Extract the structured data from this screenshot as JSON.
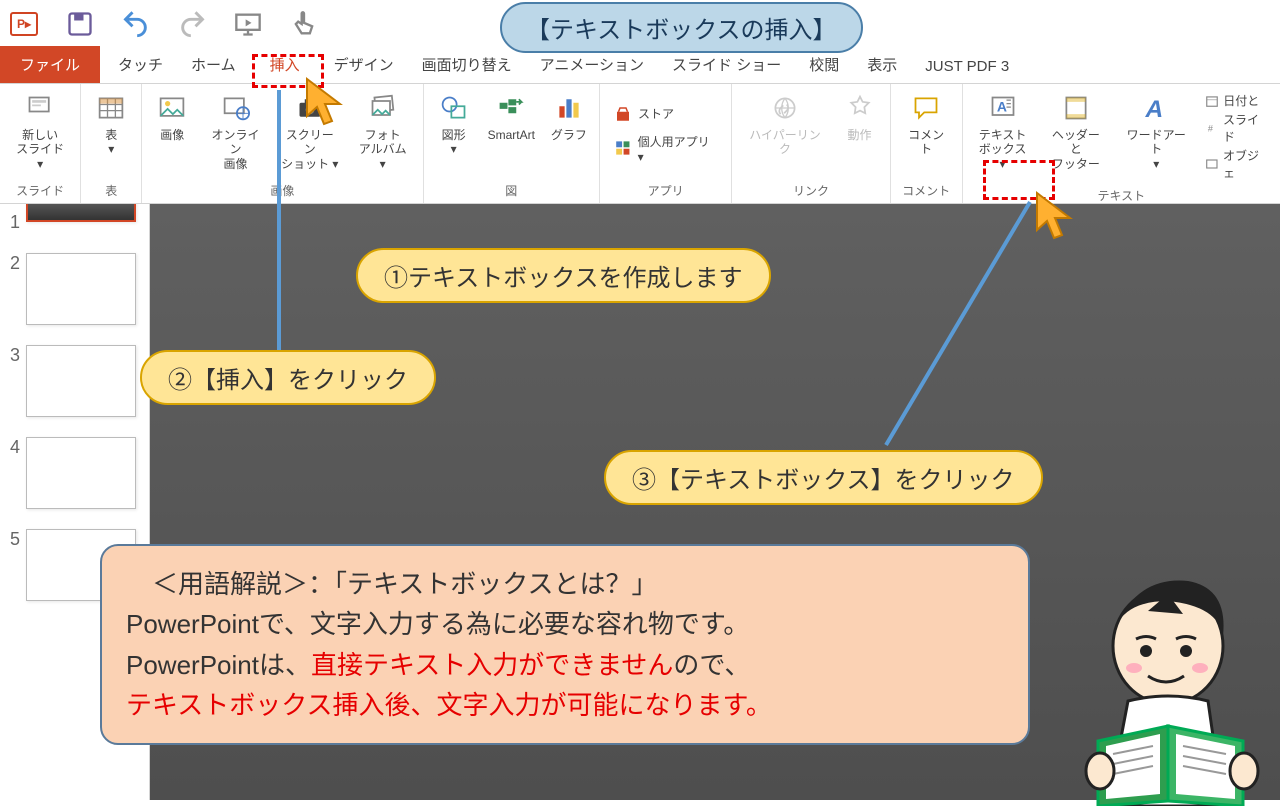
{
  "title_callout": "【テキストボックスの挿入】",
  "tabs": {
    "file": "ファイル",
    "touch": "タッチ",
    "home": "ホーム",
    "insert": "挿入",
    "design": "デザイン",
    "transition": "画面切り替え",
    "animation": "アニメーション",
    "slideshow": "スライド ショー",
    "review": "校閲",
    "view": "表示",
    "justpdf": "JUST PDF 3"
  },
  "ribbon": {
    "slide": {
      "new_slide": "新しい\nスライド ▾",
      "group": "スライド"
    },
    "table": {
      "table": "表\n▾",
      "group": "表"
    },
    "image": {
      "picture": "画像",
      "online": "オンライン\n画像",
      "screenshot": "スクリーン\nショット ▾",
      "album": "フォト\nアルバム ▾",
      "group": "画像"
    },
    "illust": {
      "shapes": "図形\n▾",
      "smartart": "SmartArt",
      "chart": "グラフ",
      "group": "図"
    },
    "app": {
      "store": "ストア",
      "myapps": "個人用アプリ ▾",
      "group": "アプリ"
    },
    "link": {
      "hyperlink": "ハイパーリンク",
      "action": "動作",
      "group": "リンク"
    },
    "comment": {
      "comment": "コメント",
      "group": "コメント"
    },
    "text": {
      "textbox": "テキスト\nボックス ▾",
      "headerfooter": "ヘッダーと\nフッター",
      "wordart": "ワードアート\n▾",
      "datetime": "日付と",
      "slidenum": "スライド",
      "object": "オブジェ",
      "group": "テキスト"
    }
  },
  "thumbs": [
    "1",
    "2",
    "3",
    "4",
    "5"
  ],
  "steps": {
    "s1": "①テキストボックスを作成します",
    "s2": "②【挿入】をクリック",
    "s3": "③【テキストボックス】をクリック"
  },
  "explain": {
    "l1a": "　＜用語解説＞：「テキストボックスとは？」",
    "l2a": "PowerPointで、文字入力する為に必要な容れ物です。",
    "l3a": "PowerPointは、",
    "l3b": "直接テキスト入力ができません",
    "l3c": "ので、",
    "l4a": "テキストボックス挿入後、文字入力が可能になります。"
  }
}
